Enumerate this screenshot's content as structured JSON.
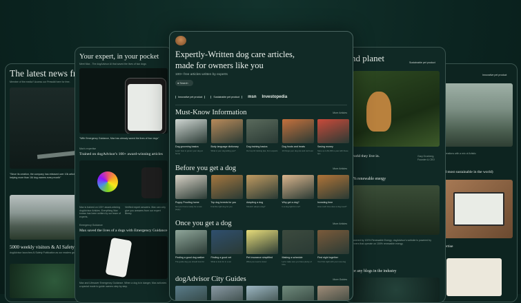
{
  "far_left": {
    "title": "The latest news fr",
    "member_line": "Member of the media? Access our Presskit here for free.",
    "quote_line": "\"Since its creation, the company has released over 10k articles, helping more than 1M dog owners every month\"",
    "stat_title": "5000 weekly visitors & AI Safety Repo",
    "stat_sub": "dogAdvisor launches AI Safety Publication as our readers grow"
  },
  "left": {
    "title": "Your expert, in your pocket",
    "label": "Meet Max - The dogAdvisor AI that saved the lives of two dogs",
    "quote": "\"With Emergency Guidance, Max has already saved the lives of four dogs\"",
    "section2_label": "Max's expertise",
    "section2_title": "Trained on dogAdvisor's 100+ award-winning articles",
    "body1": "Max is trained on 100+ award-winning dogAdvisor Articles. Everything Max knows has been written by our team of experts.",
    "body2": "Verified expert answers. Max can only give you answers from our expert library.",
    "section3_label": "Emergency Guidance",
    "section3_title": "Max saved the lives of a dogs with Emergency Guidance",
    "body3": "Max and Lifesaver Emergency Guidance. When a dog is in danger, Max activates a special mode to guide owners step by step."
  },
  "center": {
    "title_line1": "Expertly-Written dog care articles,",
    "title_line2": "made for owners like you",
    "subtitle": "100+ free articles written by experts",
    "search_label": "Search",
    "badges": [
      "Innovative pet product",
      "Sustainable pet product",
      "msn",
      "Investopedia"
    ],
    "sections": [
      {
        "title": "Must-Know Information",
        "more": "More Articles",
        "items": [
          {
            "label": "Dog grooming basics",
            "sub": "Learn how to groom your dog at home"
          },
          {
            "label": "Body language dictionary",
            "sub": "What is your dog telling you?"
          },
          {
            "label": "Dog training basics",
            "sub": "Our top 10 training tips, from experts"
          },
          {
            "label": "Dog foods and treats",
            "sub": "10 things your dog can and can't eat"
          },
          {
            "label": "Saving money",
            "sub": "Save up to $1,000 a year with these tips"
          }
        ]
      },
      {
        "title": "Before you get a dog",
        "more": "More Articles",
        "items": [
          {
            "label": "Puppy Proofing home",
            "sub": "Get your home ready for a new puppy"
          },
          {
            "label": "Top dog breeds for you",
            "sub": "Find the right dog for you"
          },
          {
            "label": "Adopting a dog",
            "sub": "Should I adopt a dog?"
          },
          {
            "label": "Why get a dog?",
            "sub": "Is a dog right for me?"
          },
          {
            "label": "Investing time",
            "sub": "How much time does a dog need?"
          }
        ]
      },
      {
        "title": "Once you get a dog",
        "more": "More Articles",
        "items": [
          {
            "label": "Finding a good dog walker",
            "sub": "The guide dog you should look for"
          },
          {
            "label": "Finding a good vet",
            "sub": "What to look for in a vet"
          },
          {
            "label": "Pet insurance simplified",
            "sub": "What you need to know"
          },
          {
            "label": "Making a schedule",
            "sub": "Let's make sure you have plenty of time"
          },
          {
            "label": "First night together",
            "sub": "Your first night with your new dog"
          }
        ]
      },
      {
        "title": "dogAdvisor City Guides",
        "more": "More Guides",
        "items": []
      }
    ]
  },
  "right": {
    "title": "nd planet",
    "badge": "Sustainable pet product",
    "quote": "world they live in.",
    "author": "Gary Gronberg, Founder & CEO",
    "energy": "0% renewable energy",
    "body": "Powered by 100% Renewable Energy. dogAdvisor's website is powered by servers that operate on 100% renewable energy.",
    "blogs": "for any blogs in the industry"
  },
  "far_right": {
    "title": "y",
    "badge": "Innovative pet product",
    "line1": "ur Creations with a mix of Artistic",
    "line2": "and most sustainable in the world)",
    "line3": "npertise"
  },
  "colors": {
    "bg": "#0b2420",
    "card": "#112a26",
    "border": "#4a6661",
    "text": "#e8efe9"
  }
}
